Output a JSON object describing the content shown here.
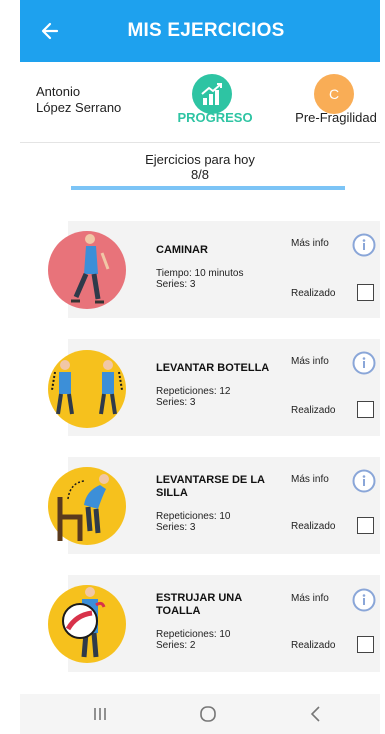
{
  "app_bar": {
    "title": "MIS EJERCICIOS",
    "color": "#1ea1ee"
  },
  "header": {
    "user_first": "Antonio",
    "user_last": "López Serrano",
    "progress_label": "PROGRESO",
    "frailty_letter": "C",
    "frailty_label": "Pre-Fragilidad",
    "progress_color": "#2ec4a3",
    "frailty_color": "#f9ad56"
  },
  "today": {
    "label": "Ejercicios para hoy",
    "count": "8/8",
    "fraction_complete": 1.0
  },
  "exercises": [
    {
      "name": "CAMINAR",
      "detail1": "Tiempo: 10 minutos",
      "detail2": "Series: 3",
      "info_label": "Más info",
      "done_label": "Realizado",
      "checked": false,
      "image": "walking-figure"
    },
    {
      "name": "LEVANTAR BOTELLA",
      "detail1": "Repeticiones: 12",
      "detail2": "Series: 3",
      "info_label": "Más info",
      "done_label": "Realizado",
      "checked": false,
      "image": "bottle-lift-figure"
    },
    {
      "name": "LEVANTARSE DE LA SILLA",
      "detail1": "Repeticiones: 10",
      "detail2": "Series: 3",
      "info_label": "Más info",
      "done_label": "Realizado",
      "checked": false,
      "image": "chair-stand-figure"
    },
    {
      "name": "ESTRUJAR UNA TOALLA",
      "detail1": "Repeticiones: 10",
      "detail2": "Series: 2",
      "info_label": "Más info",
      "done_label": "Realizado",
      "checked": false,
      "image": "towel-squeeze-figure"
    }
  ],
  "nav": {
    "items": [
      "recent-apps",
      "home",
      "back"
    ]
  }
}
